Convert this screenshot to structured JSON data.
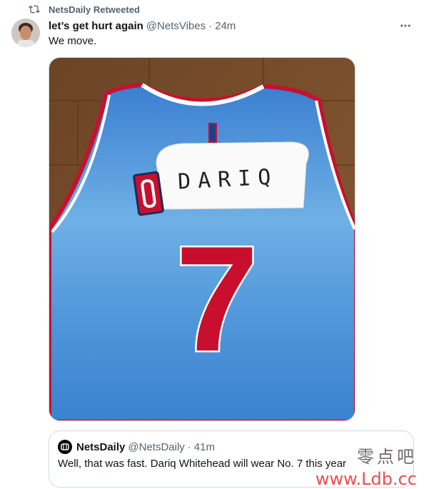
{
  "retweet": {
    "icon": "retweet-icon",
    "label": "NetsDaily Retweeted"
  },
  "tweet": {
    "display_name": "let’s get hurt again",
    "handle": "@NetsVibes",
    "separator": "·",
    "time": "24m",
    "text": "We move.",
    "more_icon": "more-icon"
  },
  "jersey": {
    "nameplate": "DARIQ",
    "number": "7",
    "colors": {
      "jersey": "#4a8fd6",
      "trim": "#c8102e",
      "number": "#c8102e"
    }
  },
  "quote": {
    "display_name": "NetsDaily",
    "handle": "@NetsDaily",
    "separator": "·",
    "time": "41m",
    "text": "Well, that was fast. Dariq Whitehead will wear No. 7 this year"
  },
  "watermark": {
    "cn": "零点吧",
    "url": "www.Ldb.cc"
  },
  "colors": {
    "text": "#0f1419",
    "muted": "#536471",
    "border": "#cfd9de"
  }
}
